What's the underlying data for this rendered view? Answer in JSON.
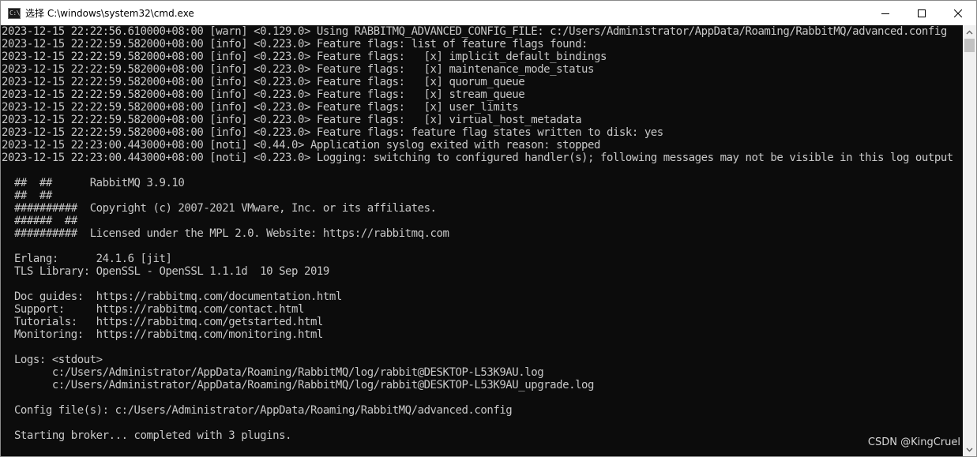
{
  "window": {
    "title": "选择 C:\\windows\\system32\\cmd.exe",
    "icon_text": "C:\\",
    "icon_name": "cmd-icon",
    "controls": [
      {
        "name": "minimize-button",
        "icon": "minimize-icon"
      },
      {
        "name": "maximize-button",
        "icon": "maximize-icon"
      },
      {
        "name": "close-button",
        "icon": "close-icon"
      }
    ]
  },
  "console": {
    "lines": [
      "2023-12-15 22:22:56.610000+08:00 [warn] <0.129.0> Using RABBITMQ_ADVANCED_CONFIG_FILE: c:/Users/Administrator/AppData/Roaming/RabbitMQ/advanced.config",
      "2023-12-15 22:22:59.582000+08:00 [info] <0.223.0> Feature flags: list of feature flags found:",
      "2023-12-15 22:22:59.582000+08:00 [info] <0.223.0> Feature flags:   [x] implicit_default_bindings",
      "2023-12-15 22:22:59.582000+08:00 [info] <0.223.0> Feature flags:   [x] maintenance_mode_status",
      "2023-12-15 22:22:59.582000+08:00 [info] <0.223.0> Feature flags:   [x] quorum_queue",
      "2023-12-15 22:22:59.582000+08:00 [info] <0.223.0> Feature flags:   [x] stream_queue",
      "2023-12-15 22:22:59.582000+08:00 [info] <0.223.0> Feature flags:   [x] user_limits",
      "2023-12-15 22:22:59.582000+08:00 [info] <0.223.0> Feature flags:   [x] virtual_host_metadata",
      "2023-12-15 22:22:59.582000+08:00 [info] <0.223.0> Feature flags: feature flag states written to disk: yes",
      "2023-12-15 22:23:00.443000+08:00 [noti] <0.44.0> Application syslog exited with reason: stopped",
      "2023-12-15 22:23:00.443000+08:00 [noti] <0.223.0> Logging: switching to configured handler(s); following messages may not be visible in this log output",
      "",
      "  ##  ##      RabbitMQ 3.9.10",
      "  ##  ##",
      "  ##########  Copyright (c) 2007-2021 VMware, Inc. or its affiliates.",
      "  ######  ##",
      "  ##########  Licensed under the MPL 2.0. Website: https://rabbitmq.com",
      "",
      "  Erlang:      24.1.6 [jit]",
      "  TLS Library: OpenSSL - OpenSSL 1.1.1d  10 Sep 2019",
      "",
      "  Doc guides:  https://rabbitmq.com/documentation.html",
      "  Support:     https://rabbitmq.com/contact.html",
      "  Tutorials:   https://rabbitmq.com/getstarted.html",
      "  Monitoring:  https://rabbitmq.com/monitoring.html",
      "",
      "  Logs: <stdout>",
      "        c:/Users/Administrator/AppData/Roaming/RabbitMQ/log/rabbit@DESKTOP-L53K9AU.log",
      "        c:/Users/Administrator/AppData/Roaming/RabbitMQ/log/rabbit@DESKTOP-L53K9AU_upgrade.log",
      "",
      "  Config file(s): c:/Users/Administrator/AppData/Roaming/RabbitMQ/advanced.config",
      "",
      "  Starting broker... completed with 3 plugins."
    ],
    "text_color": "#c8c8c8",
    "background": "#0c0c0c"
  },
  "scrollbar": {
    "up_icon": "scroll-up-arrow-icon",
    "down_icon": "scroll-down-arrow-icon"
  },
  "watermark": "CSDN @KingCruel"
}
